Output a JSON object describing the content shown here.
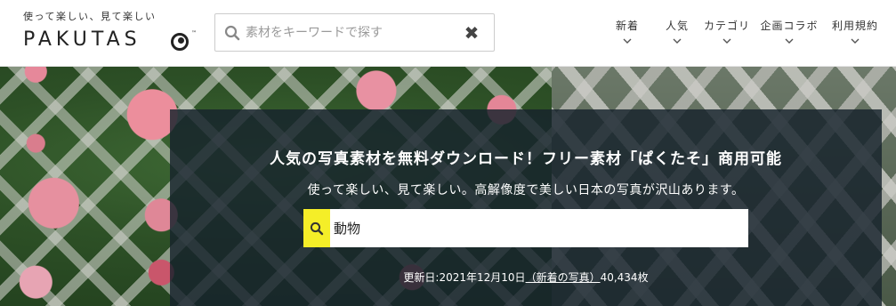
{
  "header": {
    "logo_tagline": "使って楽しい、見て楽しい",
    "logo_word": "PAKUTAS",
    "logo_tm": "™",
    "search_placeholder": "素材をキーワードで探す",
    "clear_icon": "close-icon"
  },
  "nav": [
    {
      "label": "新着"
    },
    {
      "label": "人気"
    },
    {
      "label": "カテゴリ"
    },
    {
      "label": "企画コラボ"
    },
    {
      "label": "利用規約"
    }
  ],
  "hero": {
    "title": "人気の写真素材を無料ダウンロード！フリー素材「ぱくたそ」商用可能",
    "subtitle": "使って楽しい、見て楽しい。高解像度で美しい日本の写真が沢山あります。",
    "search_value": "動物",
    "update_prefix": "更新日:",
    "update_date": "2021年12月10日",
    "update_link_label": "（新着の写真）",
    "photo_count": "40,434枚"
  },
  "colors": {
    "accent_yellow": "#f5ee28",
    "brand_pink": "#d6336c",
    "panel_bg": "#16222c"
  }
}
